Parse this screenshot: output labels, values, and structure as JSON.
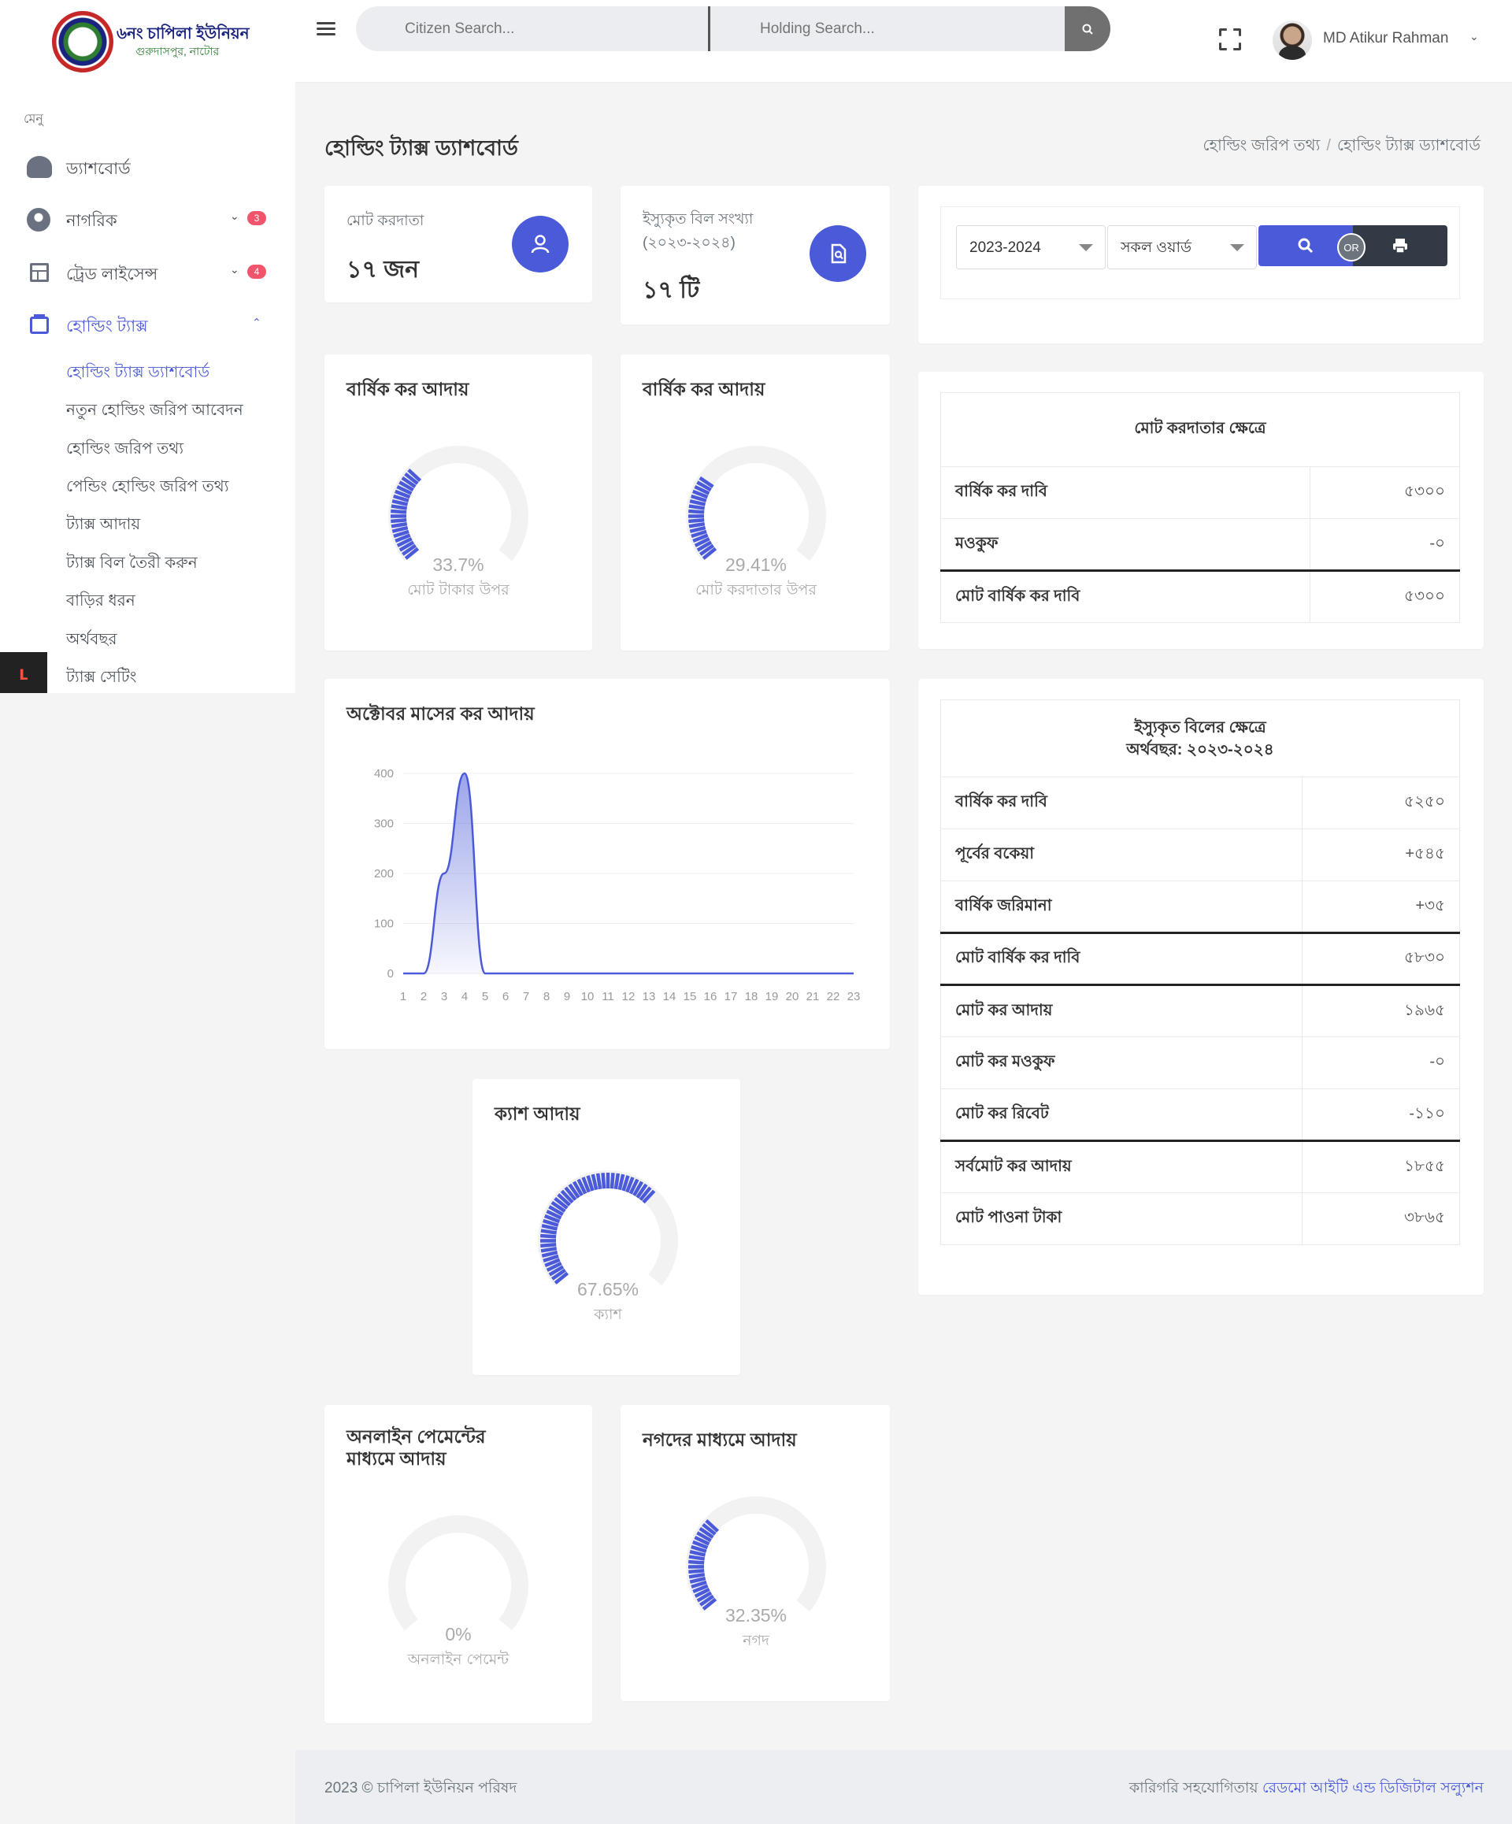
{
  "header": {
    "brand_name": "৬নং চাপিলা ইউনিয়ন",
    "brand_sub": "গুরুদাসপুর, নাটোর",
    "citizen_search_placeholder": "Citizen Search...",
    "holding_search_placeholder": "Holding Search...",
    "user_name": "MD Atikur Rahman"
  },
  "sidebar": {
    "menu_label": "মেনু",
    "items": [
      {
        "label": "ড্যাশবোর্ড"
      },
      {
        "label": "নাগরিক",
        "badge": "3"
      },
      {
        "label": "ট্রেড লাইসেন্স",
        "badge": "4"
      },
      {
        "label": "হোল্ডিং ট্যাক্স"
      }
    ],
    "sub_items": [
      "হোল্ডিং ট্যাক্স ড্যাশবোর্ড",
      "নতুন হোল্ডিং জরিপ আবেদন",
      "হোল্ডিং জরিপ তথ্য",
      "পেন্ডিং হোল্ডিং জরিপ তথ্য",
      "ট্যাক্স আদায়",
      "ট্যাক্স বিল তৈরী করুন",
      "বাড়ির ধরন",
      "অর্থবছর",
      "ট্যাক্স সেটিং"
    ]
  },
  "page": {
    "title": "হোল্ডিং ট্যাক্স ড্যাশবোর্ড",
    "breadcrumb": [
      "হোল্ডিং জরিপ তথ্য",
      "হোল্ডিং ট্যাক্স ড্যাশবোর্ড"
    ],
    "breadcrumb_sep": "/"
  },
  "stats": {
    "taxpayers_label": "মোট করদাতা",
    "taxpayers_value": "১৭ জন",
    "bills_label": "ইস্যুকৃত বিল সংখ্যা (২০২৩-২০২৪)",
    "bills_value": "১৭ টি"
  },
  "filters": {
    "year": "2023-2024",
    "ward": "সকল ওয়ার্ড",
    "or_label": "OR"
  },
  "gauges": {
    "annual1": {
      "title": "বার্ষিক কর আদায়",
      "percent": 33.7,
      "label": "33.7%",
      "sub": "মোট টাকার উপর"
    },
    "annual2": {
      "title": "বার্ষিক কর আদায়",
      "percent": 29.41,
      "label": "29.41%",
      "sub": "মোট করদাতার উপর"
    },
    "cash": {
      "title": "ক্যাশ আদায়",
      "percent": 67.65,
      "label": "67.65%",
      "sub": "ক্যাশ"
    },
    "online": {
      "title": "অনলাইন পেমেন্টের মাধ্যমে আদায়",
      "percent": 0,
      "label": "0%",
      "sub": "অনলাইন পেমেন্ট"
    },
    "nogod": {
      "title": "নগদের মাধ্যমে আদায়",
      "percent": 32.35,
      "label": "32.35%",
      "sub": "নগদ"
    }
  },
  "chart_data": {
    "type": "area",
    "title": "অক্টোবর মাসের কর আদায়",
    "x": [
      1,
      2,
      3,
      4,
      5,
      6,
      7,
      8,
      9,
      10,
      11,
      12,
      13,
      14,
      15,
      16,
      17,
      18,
      19,
      20,
      21,
      22,
      23
    ],
    "y": [
      0,
      0,
      200,
      400,
      0,
      0,
      0,
      0,
      0,
      0,
      0,
      0,
      0,
      0,
      0,
      0,
      0,
      0,
      0,
      0,
      0,
      0,
      0
    ],
    "ylim": [
      0,
      400
    ],
    "yticks": [
      0,
      100,
      200,
      300,
      400
    ],
    "color": "#4a5ad8",
    "grid": true
  },
  "summary_total": {
    "title": "মোট করদাতার ক্ষেত্রে",
    "rows": [
      {
        "label": "বার্ষিক কর দাবি",
        "value": "৫৩০০"
      },
      {
        "label": "মওকুফ",
        "value": "-০"
      },
      {
        "label": "মোট বার্ষিক কর দাবি",
        "value": "৫৩০০"
      }
    ]
  },
  "summary_issued": {
    "title_line1": "ইস্যুকৃত বিলের ক্ষেত্রে",
    "title_line2": "অর্থবছর: ২০২৩-২০২৪",
    "rows": [
      {
        "label": "বার্ষিক কর দাবি",
        "value": "৫২৫০"
      },
      {
        "label": "পূর্বের বকেয়া",
        "value": "+৫৪৫"
      },
      {
        "label": "বার্ষিক জরিমানা",
        "value": "+৩৫"
      },
      {
        "label": "মোট বার্ষিক কর দাবি",
        "value": "৫৮৩০"
      },
      {
        "label": "মোট কর আদায়",
        "value": "১৯৬৫"
      },
      {
        "label": "মোট কর মওকুফ",
        "value": "-০"
      },
      {
        "label": "মোট কর রিবেট",
        "value": "-১১০"
      },
      {
        "label": "সর্বমোট কর আদায়",
        "value": "১৮৫৫"
      },
      {
        "label": "মোট পাওনা টাকা",
        "value": "৩৮৬৫"
      }
    ]
  },
  "footer": {
    "left": "2023 © চাপিলা ইউনিয়ন পরিষদ",
    "right_prefix": "কারিগরি সহযোগিতায় ",
    "right_link": "রেডমো আইটি এন্ড ডিজিটাল সল্যুশন"
  }
}
